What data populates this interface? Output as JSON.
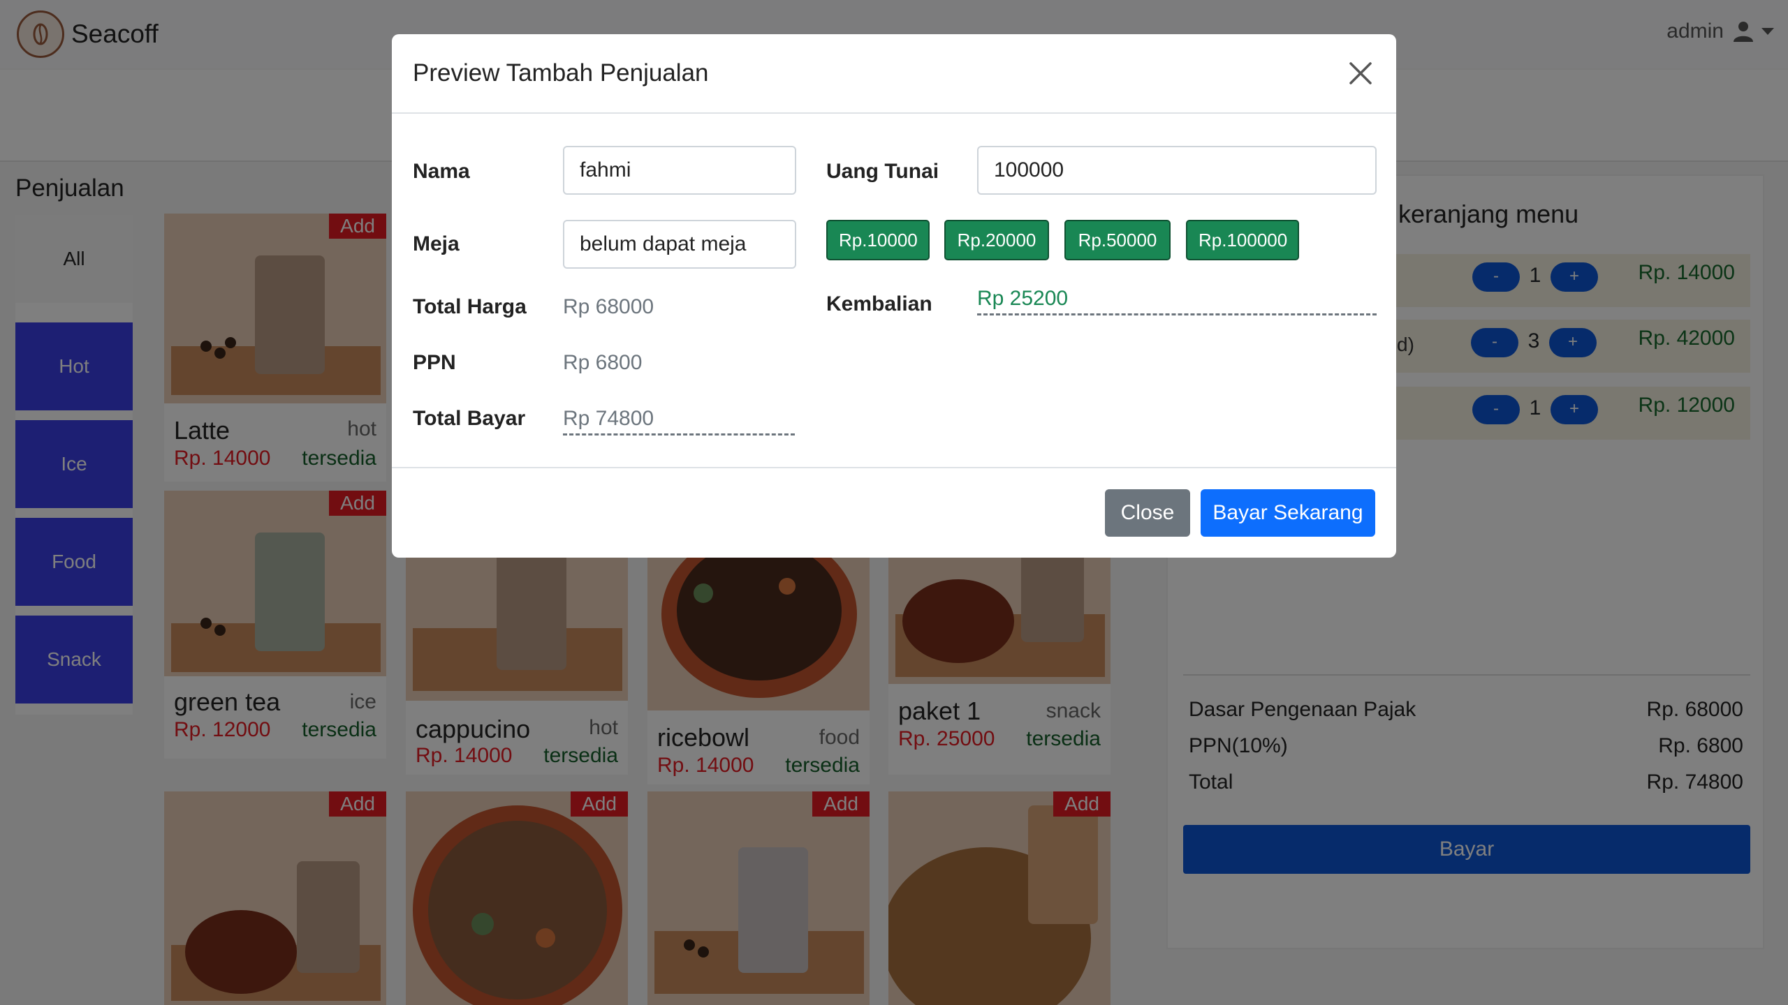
{
  "app": {
    "brand": "Seacoff",
    "user": "admin",
    "icons": {
      "logo": "coffee-logo-icon",
      "user": "user-icon",
      "caret": "caret-down-icon"
    }
  },
  "sales": {
    "title": "Penjualan",
    "categories": [
      "All",
      "Hot",
      "Ice",
      "Food",
      "Snack"
    ],
    "add_label": "Add",
    "products": [
      {
        "name": "Latte",
        "type": "hot",
        "price": "Rp. 14000",
        "stock": "tersedia"
      },
      {
        "name": "green tea",
        "type": "ice",
        "price": "Rp. 12000",
        "stock": "tersedia"
      },
      {
        "name": "cappucino",
        "type": "hot",
        "price": "Rp. 14000",
        "stock": "tersedia"
      },
      {
        "name": "ricebowl",
        "type": "food",
        "price": "Rp. 14000",
        "stock": "tersedia"
      },
      {
        "name": "paket 1",
        "type": "snack",
        "price": "Rp. 25000",
        "stock": "tersedia"
      }
    ]
  },
  "cart": {
    "title": "keranjang menu",
    "items": [
      {
        "name": "",
        "qty": "1",
        "price": "Rp. 14000"
      },
      {
        "name": "d)",
        "qty": "3",
        "price": "Rp. 42000"
      },
      {
        "name": "",
        "qty": "1",
        "price": "Rp. 12000"
      }
    ],
    "minus": "-",
    "plus": "+",
    "summary": [
      {
        "label": "Dasar Pengenaan Pajak",
        "value": "Rp. 68000"
      },
      {
        "label": "PPN(10%)",
        "value": "Rp. 6800"
      },
      {
        "label": "Total",
        "value": "Rp. 74800"
      }
    ],
    "bayar": "Bayar"
  },
  "modal": {
    "title": "Preview Tambah Penjualan",
    "close_icon": "close-icon",
    "nama_label": "Nama",
    "nama_value": "fahmi",
    "meja_label": "Meja",
    "meja_value": "belum dapat meja",
    "total_harga_label": "Total Harga",
    "total_harga_value": "Rp 68000",
    "ppn_label": "PPN",
    "ppn_value": "Rp 6800",
    "total_bayar_label": "Total Bayar",
    "total_bayar_value": "Rp 74800",
    "uang_tunai_label": "Uang Tunai",
    "uang_tunai_value": "100000",
    "quick_amounts": [
      "Rp.10000",
      "Rp.20000",
      "Rp.50000",
      "Rp.100000"
    ],
    "kembalian_label": "Kembalian",
    "kembalian_value": "Rp 25200",
    "close_button": "Close",
    "pay_button": "Bayar Sekarang"
  }
}
